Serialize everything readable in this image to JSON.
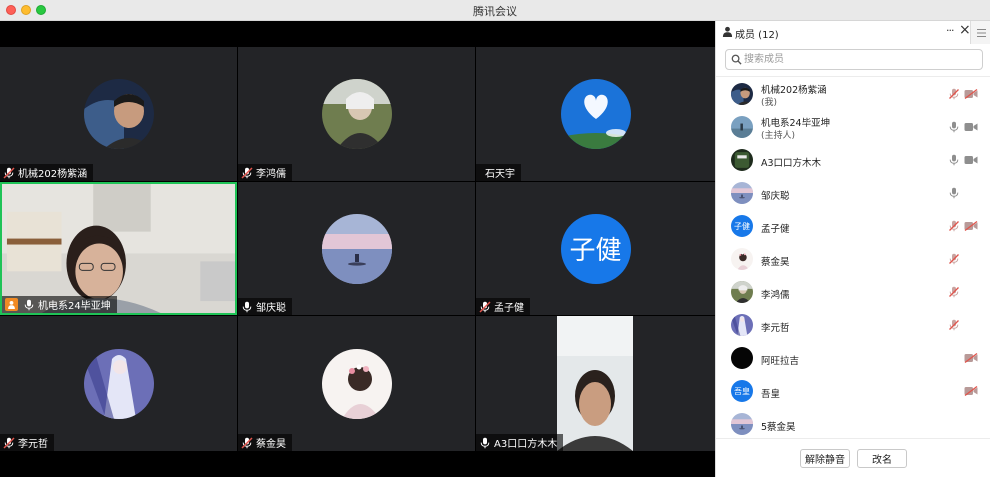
{
  "window": {
    "title": "腾讯会议"
  },
  "tiles": [
    {
      "name": "机械202杨紫涵",
      "mic": "muted",
      "avatar": "photo-man"
    },
    {
      "name": "李鸿儒",
      "mic": "muted",
      "avatar": "photo-field"
    },
    {
      "name": "石天宇",
      "mic": "none",
      "avatar": "photo-heart-cloud"
    },
    {
      "name": "机电系24毕亚坤",
      "mic": "on",
      "avatar": "video",
      "active": true
    },
    {
      "name": "邹庆聪",
      "mic": "on",
      "avatar": "photo-lake"
    },
    {
      "name": "孟子健",
      "mic": "muted",
      "avatar_text": "子健"
    },
    {
      "name": "李元哲",
      "mic": "muted",
      "avatar": "photo-anime"
    },
    {
      "name": "蔡金昊",
      "mic": "muted",
      "avatar": "photo-flower-girl"
    },
    {
      "name": "A3口口方木木",
      "mic": "on",
      "avatar": "video-portrait"
    }
  ],
  "panel": {
    "title": "成员 (12)",
    "search_placeholder": "搜索成员",
    "members": [
      {
        "name": "机械202杨紫涵",
        "role": "(我)",
        "mic": "muted",
        "cam": "off"
      },
      {
        "name": "机电系24毕亚坤",
        "role": "(主持人)",
        "mic": "on",
        "cam": "on"
      },
      {
        "name": "A3口口方木木",
        "mic": "on",
        "cam": "on"
      },
      {
        "name": "邹庆聪",
        "mic": "on",
        "cam": "none"
      },
      {
        "name": "孟子健",
        "avatar_text": "子健",
        "mic": "muted",
        "cam": "off"
      },
      {
        "name": "蔡金昊",
        "mic": "muted",
        "cam": "none"
      },
      {
        "name": "李鸿儒",
        "mic": "muted",
        "cam": "none"
      },
      {
        "name": "李元哲",
        "mic": "muted",
        "cam": "none"
      },
      {
        "name": "阿旺拉吉",
        "mic": "none",
        "cam": "off"
      },
      {
        "name": "吾皇",
        "avatar_text": "吾皇",
        "mic": "none",
        "cam": "off"
      },
      {
        "name": "5蔡金昊",
        "mic": "none",
        "cam": "none"
      }
    ],
    "unmute_all_label": "解除静音",
    "rename_label": "改名"
  },
  "colors": {
    "active_border": "#1fc357",
    "muted_red": "#e0554d",
    "avatar_blue": "#1778e9"
  }
}
